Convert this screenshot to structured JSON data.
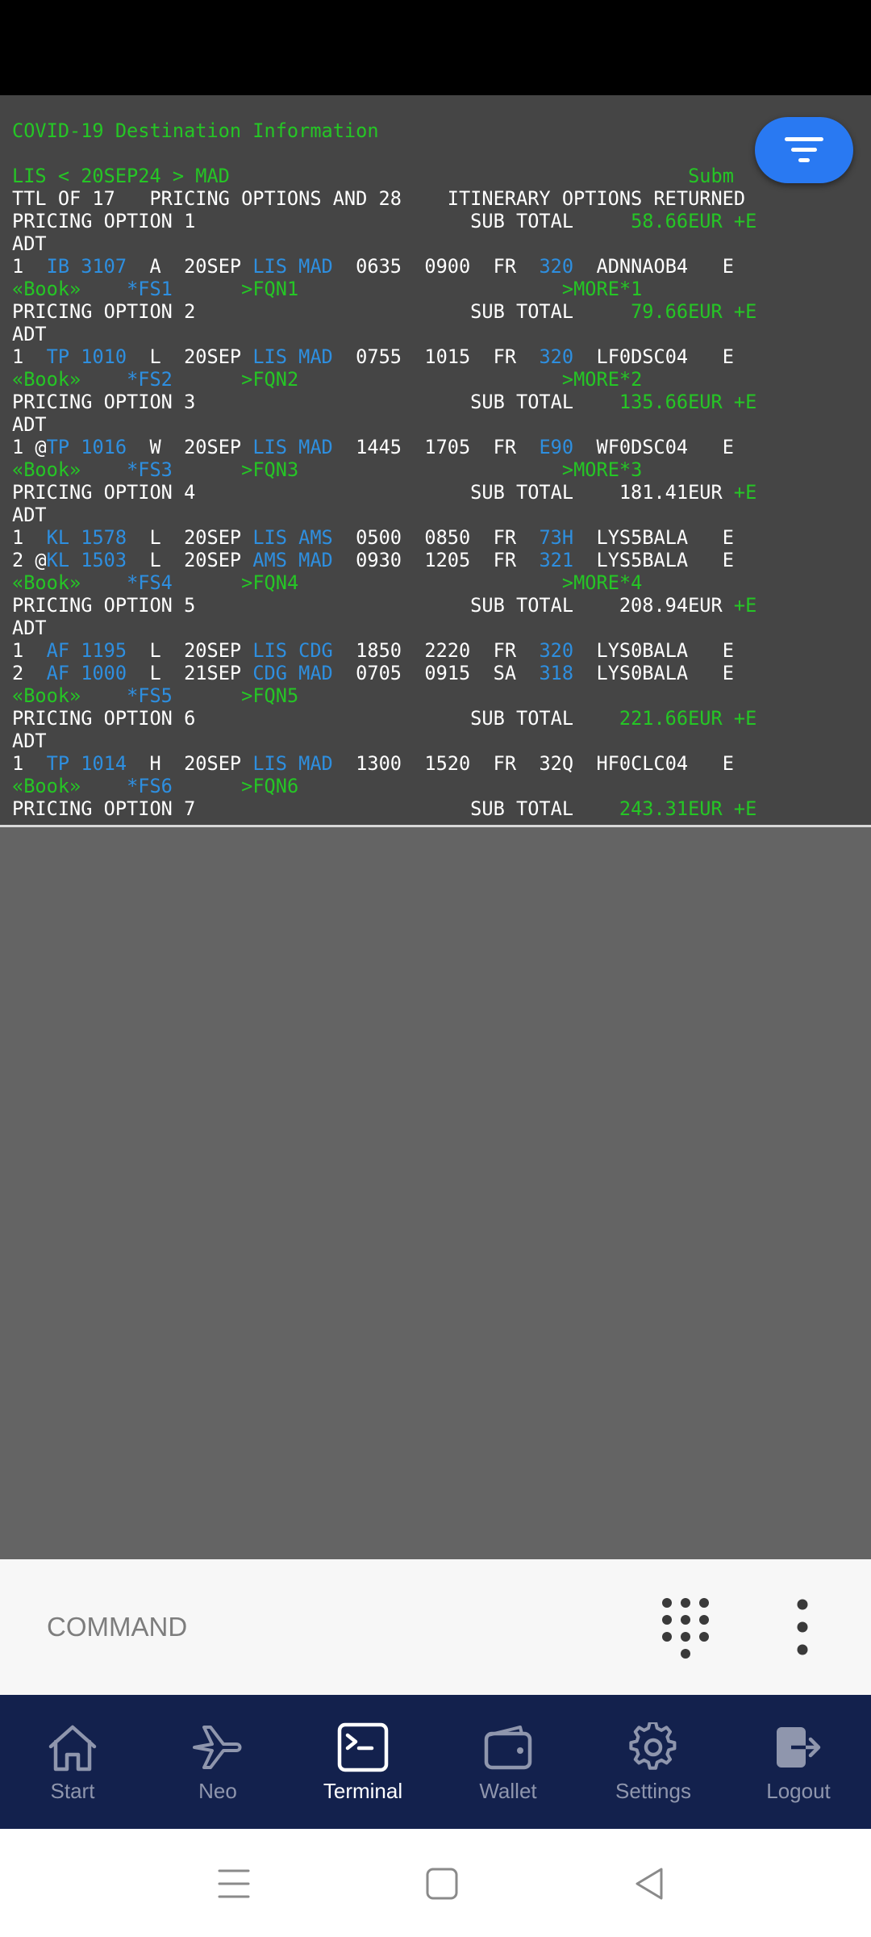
{
  "terminal": {
    "lines": [
      [
        [
          "g",
          "COVID-19 Destination Information"
        ]
      ],
      [],
      [
        [
          "g",
          "LIS < 20SEP24 > MAD"
        ],
        [
          "g",
          "                                        Subm"
        ]
      ],
      [
        [
          "w",
          "TTL OF 17   PRICING OPTIONS AND 28    ITINERARY OPTIONS RETURNED"
        ]
      ],
      [
        [
          "w",
          "PRICING OPTION 1                        SUB TOTAL     "
        ],
        [
          "g",
          "58.66EUR +E"
        ]
      ],
      [
        [
          "w",
          "ADT"
        ]
      ],
      [
        [
          "w",
          "1  "
        ],
        [
          "b",
          "IB 3107"
        ],
        [
          "w",
          "  A  20SEP "
        ],
        [
          "b",
          "LIS MAD"
        ],
        [
          "w",
          "  0635  0900  FR  "
        ],
        [
          "b",
          "320"
        ],
        [
          "w",
          "  ADNNAOB4   E"
        ]
      ],
      [
        [
          "g",
          "«Book»"
        ],
        [
          "w",
          "    "
        ],
        [
          "b",
          "*FS1"
        ],
        [
          "w",
          "      "
        ],
        [
          "g",
          ">FQN1"
        ],
        [
          "w",
          "                       "
        ],
        [
          "g",
          ">MORE*1"
        ]
      ],
      [
        [
          "w",
          "PRICING OPTION 2                        SUB TOTAL     "
        ],
        [
          "g",
          "79.66EUR +E"
        ]
      ],
      [
        [
          "w",
          "ADT"
        ]
      ],
      [
        [
          "w",
          "1  "
        ],
        [
          "b",
          "TP 1010"
        ],
        [
          "w",
          "  L  20SEP "
        ],
        [
          "b",
          "LIS MAD"
        ],
        [
          "w",
          "  0755  1015  FR  "
        ],
        [
          "b",
          "320"
        ],
        [
          "w",
          "  LF0DSC04   E"
        ]
      ],
      [
        [
          "g",
          "«Book»"
        ],
        [
          "w",
          "    "
        ],
        [
          "b",
          "*FS2"
        ],
        [
          "w",
          "      "
        ],
        [
          "g",
          ">FQN2"
        ],
        [
          "w",
          "                       "
        ],
        [
          "g",
          ">MORE*2"
        ]
      ],
      [
        [
          "w",
          "PRICING OPTION 3                        SUB TOTAL    "
        ],
        [
          "g",
          "135.66EUR +E"
        ]
      ],
      [
        [
          "w",
          "ADT"
        ]
      ],
      [
        [
          "w",
          "1 @"
        ],
        [
          "b",
          "TP 1016"
        ],
        [
          "w",
          "  W  20SEP "
        ],
        [
          "b",
          "LIS MAD"
        ],
        [
          "w",
          "  1445  1705  FR  "
        ],
        [
          "b",
          "E90"
        ],
        [
          "w",
          "  WF0DSC04   E"
        ]
      ],
      [
        [
          "g",
          "«Book»"
        ],
        [
          "w",
          "    "
        ],
        [
          "b",
          "*FS3"
        ],
        [
          "w",
          "      "
        ],
        [
          "g",
          ">FQN3"
        ],
        [
          "w",
          "                       "
        ],
        [
          "g",
          ">MORE*3"
        ]
      ],
      [
        [
          "w",
          "PRICING OPTION 4                        SUB TOTAL    181.41EUR "
        ],
        [
          "g",
          "+E"
        ]
      ],
      [
        [
          "w",
          "ADT"
        ]
      ],
      [
        [
          "w",
          "1  "
        ],
        [
          "b",
          "KL 1578"
        ],
        [
          "w",
          "  L  20SEP "
        ],
        [
          "b",
          "LIS AMS"
        ],
        [
          "w",
          "  0500  0850  FR  "
        ],
        [
          "b",
          "73H"
        ],
        [
          "w",
          "  LYS5BALA   E"
        ]
      ],
      [
        [
          "w",
          "2 @"
        ],
        [
          "b",
          "KL 1503"
        ],
        [
          "w",
          "  L  20SEP "
        ],
        [
          "b",
          "AMS MAD"
        ],
        [
          "w",
          "  0930  1205  FR  "
        ],
        [
          "b",
          "321"
        ],
        [
          "w",
          "  LYS5BALA   E"
        ]
      ],
      [
        [
          "g",
          "«Book»"
        ],
        [
          "w",
          "    "
        ],
        [
          "b",
          "*FS4"
        ],
        [
          "w",
          "      "
        ],
        [
          "g",
          ">FQN4"
        ],
        [
          "w",
          "                       "
        ],
        [
          "g",
          ">MORE*4"
        ]
      ],
      [
        [
          "w",
          "PRICING OPTION 5                        SUB TOTAL    208.94EUR "
        ],
        [
          "g",
          "+E"
        ]
      ],
      [
        [
          "w",
          "ADT"
        ]
      ],
      [
        [
          "w",
          "1  "
        ],
        [
          "b",
          "AF 1195"
        ],
        [
          "w",
          "  L  20SEP "
        ],
        [
          "b",
          "LIS CDG"
        ],
        [
          "w",
          "  1850  2220  FR  "
        ],
        [
          "b",
          "320"
        ],
        [
          "w",
          "  LYS0BALA   E"
        ]
      ],
      [
        [
          "w",
          "2  "
        ],
        [
          "b",
          "AF 1000"
        ],
        [
          "w",
          "  L  21SEP "
        ],
        [
          "b",
          "CDG MAD"
        ],
        [
          "w",
          "  0705  0915  SA  "
        ],
        [
          "b",
          "318"
        ],
        [
          "w",
          "  LYS0BALA   E"
        ]
      ],
      [
        [
          "g",
          "«Book»"
        ],
        [
          "w",
          "    "
        ],
        [
          "b",
          "*FS5"
        ],
        [
          "w",
          "      "
        ],
        [
          "g",
          ">FQN5"
        ]
      ],
      [
        [
          "w",
          "PRICING OPTION 6                        SUB TOTAL    "
        ],
        [
          "g",
          "221.66EUR +E"
        ]
      ],
      [
        [
          "w",
          "ADT"
        ]
      ],
      [
        [
          "w",
          "1  "
        ],
        [
          "b",
          "TP 1014"
        ],
        [
          "w",
          "  H  20SEP "
        ],
        [
          "b",
          "LIS MAD"
        ],
        [
          "w",
          "  1300  1520  FR  32Q  HF0CLC04   E"
        ]
      ],
      [
        [
          "g",
          "«Book»"
        ],
        [
          "w",
          "    "
        ],
        [
          "b",
          "*FS6"
        ],
        [
          "w",
          "      "
        ],
        [
          "g",
          ">FQN6"
        ]
      ],
      [
        [
          "w",
          "PRICING OPTION 7                        SUB TOTAL    "
        ],
        [
          "g",
          "243.31EUR +E"
        ]
      ]
    ]
  },
  "command": {
    "placeholder": "COMMAND"
  },
  "nav": {
    "items": [
      {
        "label": "Start",
        "icon": "home-icon"
      },
      {
        "label": "Neo",
        "icon": "airplane-icon"
      },
      {
        "label": "Terminal",
        "icon": "terminal-icon"
      },
      {
        "label": "Wallet",
        "icon": "wallet-icon"
      },
      {
        "label": "Settings",
        "icon": "gear-icon"
      },
      {
        "label": "Logout",
        "icon": "logout-icon"
      }
    ],
    "active": "Terminal"
  },
  "colors": {
    "terminal_bg": "#454545",
    "green": "#25c625",
    "blue": "#2e8fe0",
    "nav_bg": "#13214d",
    "fab": "#2979f2"
  }
}
